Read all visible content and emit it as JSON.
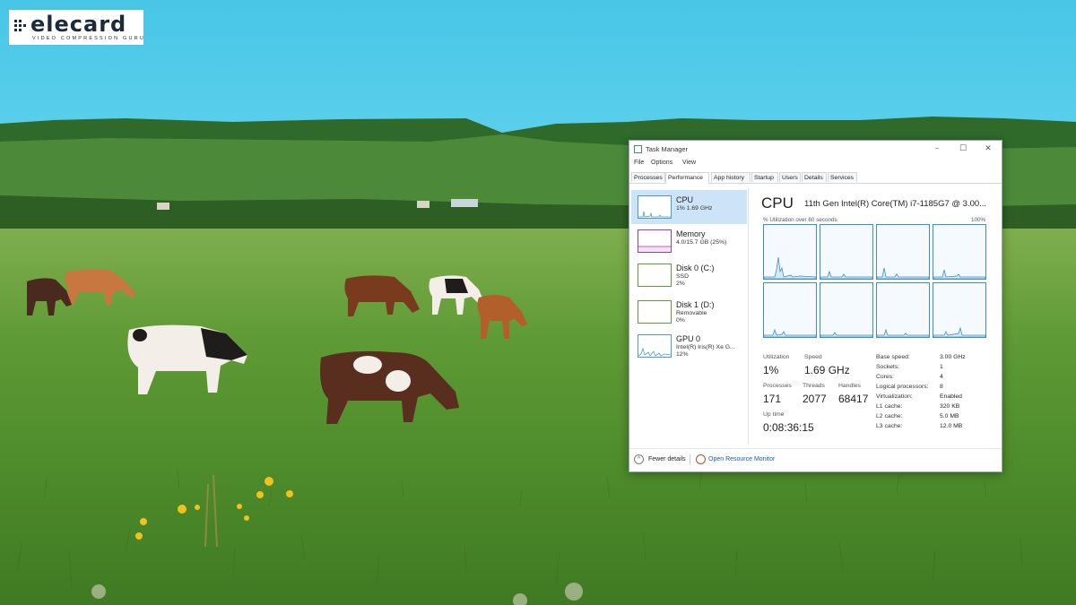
{
  "logo": {
    "wordmark": "elecard",
    "tagline": "VIDEO COMPRESSION GURU"
  },
  "window": {
    "title": "Task Manager",
    "controls": {
      "minimize": "–",
      "maximize": "☐",
      "close": "✕"
    }
  },
  "menu": [
    "File",
    "Options",
    "View"
  ],
  "tabs": [
    "Processes",
    "Performance",
    "App history",
    "Startup",
    "Users",
    "Details",
    "Services"
  ],
  "active_tab": "Performance",
  "sidebar": {
    "items": [
      {
        "name": "CPU",
        "sub1": "1% 1.69 GHz",
        "sub2": "",
        "color": "#4a9ccf"
      },
      {
        "name": "Memory",
        "sub1": "4.0/15.7 GB (25%)",
        "sub2": "",
        "color": "#9b3fa8"
      },
      {
        "name": "Disk 0 (C:)",
        "sub1": "SSD",
        "sub2": "2%",
        "color": "#5a9e3a"
      },
      {
        "name": "Disk 1 (D:)",
        "sub1": "Removable",
        "sub2": "0%",
        "color": "#5a9e3a"
      },
      {
        "name": "GPU 0",
        "sub1": "Intel(R) Iris(R) Xe G...",
        "sub2": "12%",
        "color": "#4a9ccf"
      }
    ]
  },
  "cpu": {
    "title": "CPU",
    "model": "11th Gen Intel(R) Core(TM) i7-1185G7 @ 3.00...",
    "graph_label": "% Utilization over 60 seconds",
    "graph_max": "100%",
    "stats": {
      "utilization_label": "Utilization",
      "utilization": "1%",
      "speed_label": "Speed",
      "speed": "1.69 GHz",
      "processes_label": "Processes",
      "processes": "171",
      "threads_label": "Threads",
      "threads": "2077",
      "handles_label": "Handles",
      "handles": "68417",
      "uptime_label": "Up time",
      "uptime": "0:08:36:15"
    },
    "specs": [
      {
        "label": "Base speed:",
        "value": "3.00 GHz"
      },
      {
        "label": "Sockets:",
        "value": "1"
      },
      {
        "label": "Cores:",
        "value": "4"
      },
      {
        "label": "Logical processors:",
        "value": "8"
      },
      {
        "label": "Virtualization:",
        "value": "Enabled"
      },
      {
        "label": "L1 cache:",
        "value": "320 KB"
      },
      {
        "label": "L2 cache:",
        "value": "5.0 MB"
      },
      {
        "label": "L3 cache:",
        "value": "12.0 MB"
      }
    ]
  },
  "footer": {
    "fewer_details": "Fewer details",
    "resource_monitor": "Open Resource Monitor"
  }
}
